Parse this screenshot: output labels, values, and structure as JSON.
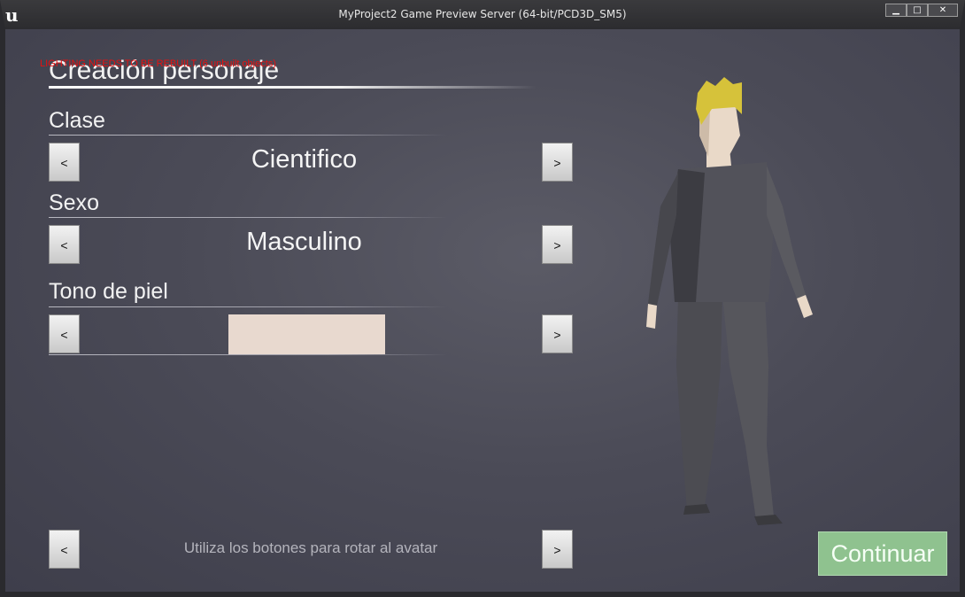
{
  "window": {
    "title": "MyProject2 Game Preview Server (64-bit/PCD3D_SM5)",
    "minimize_glyph": "▁",
    "maximize_glyph": "□",
    "close_glyph": "✕",
    "logo_glyph": "u"
  },
  "warning": "LIGHTING NEEDS TO BE REBUILT (6 unbuilt objects)",
  "panel": {
    "title": "Creación personaje",
    "sections": [
      {
        "label": "Clase",
        "value": "Cientifico"
      },
      {
        "label": "Sexo",
        "value": "Masculino"
      },
      {
        "label": "Tono de piel",
        "swatch_color": "#e8d9cf"
      }
    ],
    "prev_glyph": "<",
    "next_glyph": ">"
  },
  "rotate": {
    "hint": "Utiliza los botones para rotar al avatar"
  },
  "continue_label": "Continuar",
  "colors": {
    "accent_green": "#8fc28f",
    "warning_red": "#e81010",
    "avatar_suit": "#4a4a50",
    "avatar_hair": "#d6c23a",
    "avatar_skin": "#e9d9c8"
  }
}
